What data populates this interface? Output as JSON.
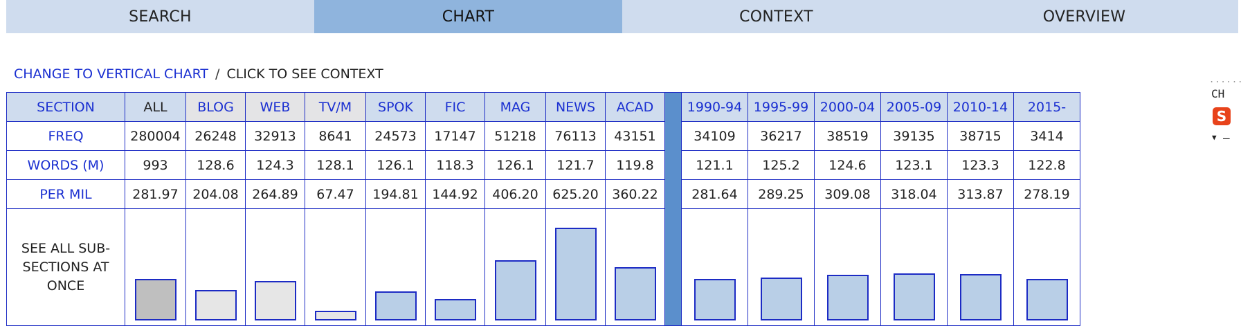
{
  "tabs": [
    {
      "label": "SEARCH",
      "active": false
    },
    {
      "label": "CHART",
      "active": true
    },
    {
      "label": "CONTEXT",
      "active": false
    },
    {
      "label": "OVERVIEW",
      "active": false
    }
  ],
  "toolbar": {
    "change_chart_link": "CHANGE TO VERTICAL CHART",
    "separator": "/",
    "click_hint": "CLICK TO SEE CONTEXT"
  },
  "table": {
    "row_labels": {
      "section": "SECTION",
      "freq": "FREQ",
      "words": "WORDS (M)",
      "permil": "PER MIL",
      "see_all": "SEE ALL SUB-SECTIONS AT ONCE"
    },
    "columns": [
      {
        "name": "ALL",
        "freq": "280004",
        "words": "993",
        "permil": "281.97"
      },
      {
        "name": "BLOG",
        "freq": "26248",
        "words": "128.6",
        "permil": "204.08"
      },
      {
        "name": "WEB",
        "freq": "32913",
        "words": "124.3",
        "permil": "264.89"
      },
      {
        "name": "TV/M",
        "freq": "8641",
        "words": "128.1",
        "permil": "67.47"
      },
      {
        "name": "SPOK",
        "freq": "24573",
        "words": "126.1",
        "permil": "194.81"
      },
      {
        "name": "FIC",
        "freq": "17147",
        "words": "118.3",
        "permil": "144.92"
      },
      {
        "name": "MAG",
        "freq": "51218",
        "words": "126.1",
        "permil": "406.20"
      },
      {
        "name": "NEWS",
        "freq": "76113",
        "words": "121.7",
        "permil": "625.20"
      },
      {
        "name": "ACAD",
        "freq": "43151",
        "words": "119.8",
        "permil": "360.22"
      },
      {
        "name": "1990-94",
        "freq": "34109",
        "words": "121.1",
        "permil": "281.64"
      },
      {
        "name": "1995-99",
        "freq": "36217",
        "words": "125.2",
        "permil": "289.25"
      },
      {
        "name": "2000-04",
        "freq": "38519",
        "words": "124.6",
        "permil": "309.08"
      },
      {
        "name": "2005-09",
        "freq": "39135",
        "words": "123.1",
        "permil": "318.04"
      },
      {
        "name": "2010-14",
        "freq": "38715",
        "words": "123.3",
        "permil": "313.87"
      },
      {
        "name": "2015-",
        "freq": "3414",
        "words": "122.8",
        "permil": "278.19"
      }
    ]
  },
  "widget": {
    "dots": "......",
    "label": "CH",
    "icon": "S"
  },
  "colors": {
    "tab_bg": "#cfdcee",
    "tab_active_bg": "#8fb4dd",
    "link": "#1a2fd1",
    "border": "#1c2bc4",
    "separator_col": "#5b8fcc",
    "bar_all": "#bfbfbf",
    "bar_gray": "#e6e6e6",
    "bar_blue": "#b9cfe7"
  }
}
